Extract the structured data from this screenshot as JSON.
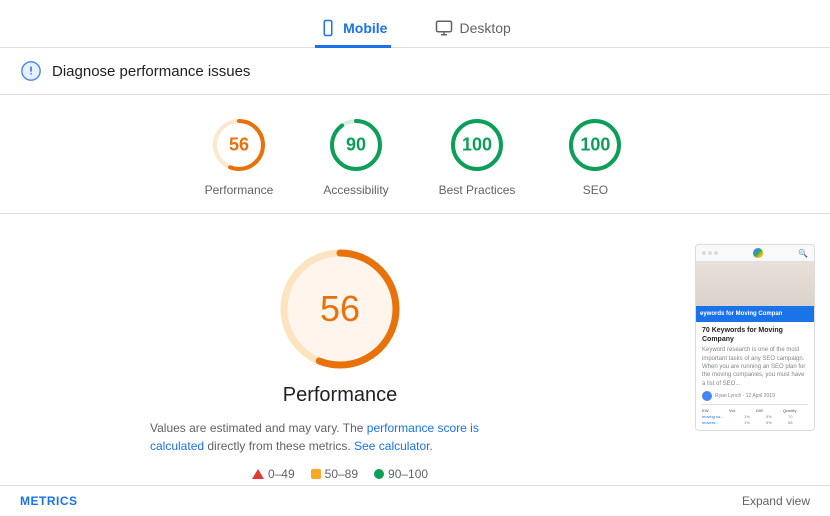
{
  "tabs": [
    {
      "id": "mobile",
      "label": "Mobile",
      "active": true
    },
    {
      "id": "desktop",
      "label": "Desktop",
      "active": false
    }
  ],
  "diagnose": {
    "title": "Diagnose performance issues"
  },
  "scores": [
    {
      "id": "performance",
      "value": 56,
      "label": "Performance",
      "color": "#e8710a",
      "bg": "#fce8d0",
      "radius": 24,
      "stroke": 4,
      "pct": 0.56
    },
    {
      "id": "accessibility",
      "value": 90,
      "label": "Accessibility",
      "color": "#0d9e5a",
      "bg": "#d4f0e3",
      "radius": 24,
      "stroke": 4,
      "pct": 0.9
    },
    {
      "id": "best-practices",
      "value": 100,
      "label": "Best Practices",
      "color": "#0d9e5a",
      "bg": "#d4f0e3",
      "radius": 24,
      "stroke": 4,
      "pct": 1.0
    },
    {
      "id": "seo",
      "value": 100,
      "label": "SEO",
      "color": "#0d9e5a",
      "bg": "#d4f0e3",
      "radius": 24,
      "stroke": 4,
      "pct": 1.0
    }
  ],
  "performance": {
    "value": 56,
    "title": "Performance",
    "description_prefix": "Values are estimated and may vary. The",
    "description_link1": "performance score is calculated",
    "description_link1_href": "#",
    "description_middle": "directly from these metrics.",
    "description_link2": "See calculator",
    "description_link2_href": "#"
  },
  "legend": [
    {
      "type": "triangle",
      "color": "#e53935",
      "range": "0–49"
    },
    {
      "type": "square",
      "color": "#f9a825",
      "range": "50–89"
    },
    {
      "type": "dot",
      "color": "#0d9e5a",
      "range": "90–100"
    }
  ],
  "metrics_footer": {
    "left_label": "METRICS",
    "right_label": "Expand view"
  },
  "phone_preview": {
    "blue_bar_text": "eywords for Moving Compan",
    "title": "70 Keywords for Moving Company",
    "subtitle_lines": "Keyword research is one of the most important tasks of any SEO campaign. When you are running an SEO plan for the moving companies, you must have a list of SEO..."
  }
}
